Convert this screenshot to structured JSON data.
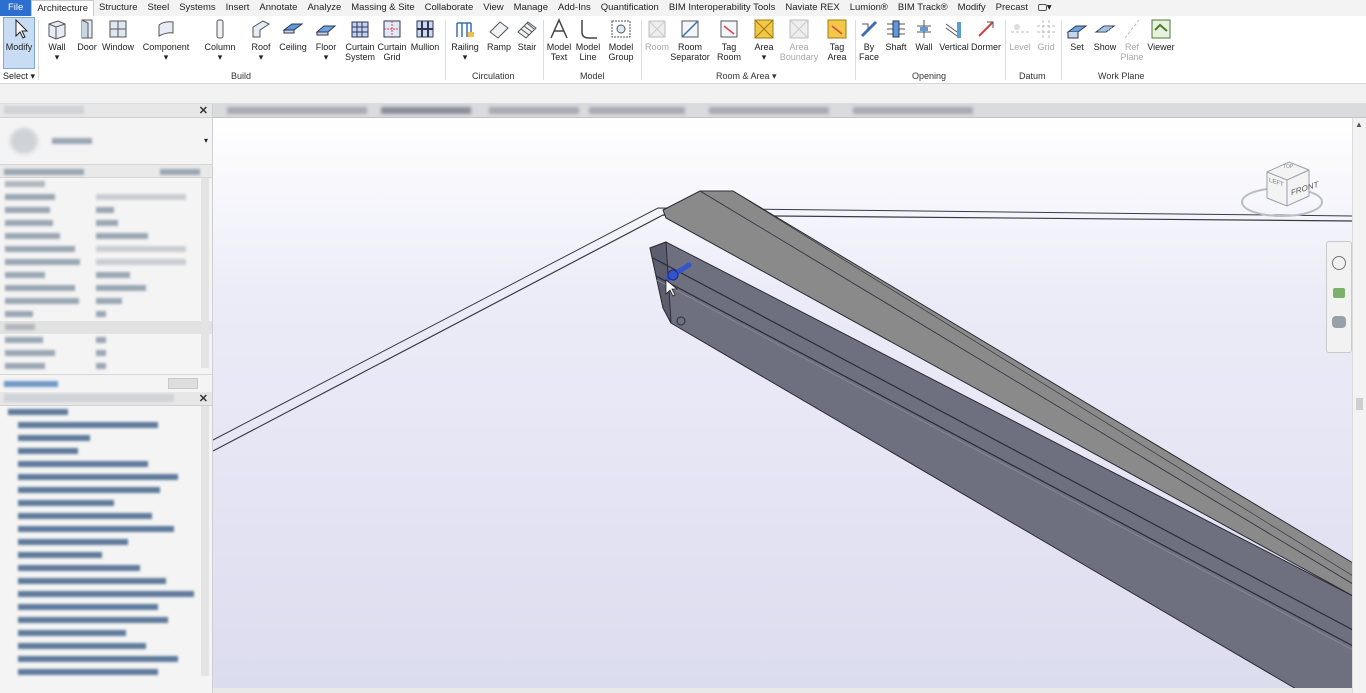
{
  "menu": [
    "File",
    "Architecture",
    "Structure",
    "Steel",
    "Systems",
    "Insert",
    "Annotate",
    "Analyze",
    "Massing & Site",
    "Collaborate",
    "View",
    "Manage",
    "Add-Ins",
    "Quantification",
    "BIM Interoperability Tools",
    "Naviate REX",
    "Lumion®",
    "BIM Track®",
    "Modify",
    "Precast"
  ],
  "ribbon": {
    "modify": "Modify",
    "select": "Select",
    "build": {
      "wall": "Wall",
      "door": "Door",
      "window": "Window",
      "component": "Component",
      "column": "Column",
      "roof": "Roof",
      "ceiling": "Ceiling",
      "floor": "Floor",
      "curtain_system_1": "Curtain",
      "curtain_system_2": "System",
      "curtain_grid_1": "Curtain",
      "curtain_grid_2": "Grid",
      "mullion": "Mullion",
      "label": "Build"
    },
    "circulation": {
      "railing": "Railing",
      "ramp": "Ramp",
      "stair": "Stair",
      "label": "Circulation"
    },
    "model": {
      "model_text_1": "Model",
      "model_text_2": "Text",
      "model_line_1": "Model",
      "model_line_2": "Line",
      "model_group_1": "Model",
      "model_group_2": "Group",
      "label": "Model"
    },
    "room_area": {
      "room": "Room",
      "room_sep_1": "Room",
      "room_sep_2": "Separator",
      "tag_room_1": "Tag",
      "tag_room_2": "Room",
      "area": "Area",
      "area_boundary_1": "Area",
      "area_boundary_2": "Boundary",
      "tag_area_1": "Tag",
      "tag_area_2": "Area",
      "label": "Room & Area"
    },
    "opening": {
      "by_face_1": "By",
      "by_face_2": "Face",
      "shaft": "Shaft",
      "wall": "Wall",
      "vertical": "Vertical",
      "dormer": "Dormer",
      "label": "Opening"
    },
    "datum": {
      "level": "Level",
      "grid": "Grid",
      "label": "Datum"
    },
    "work_plane": {
      "set": "Set",
      "show": "Show",
      "ref_plane_1": "Ref",
      "ref_plane_2": "Plane",
      "viewer": "Viewer",
      "label": "Work Plane"
    }
  },
  "viewcube": {
    "front": "FRONT",
    "left": "LEFT",
    "top": "TOP"
  },
  "colors": {
    "accent": "#2c6fd1",
    "beam_side": "#6e7080",
    "beam_top": "#8a8a8a",
    "slab": "#e7e7f7"
  }
}
